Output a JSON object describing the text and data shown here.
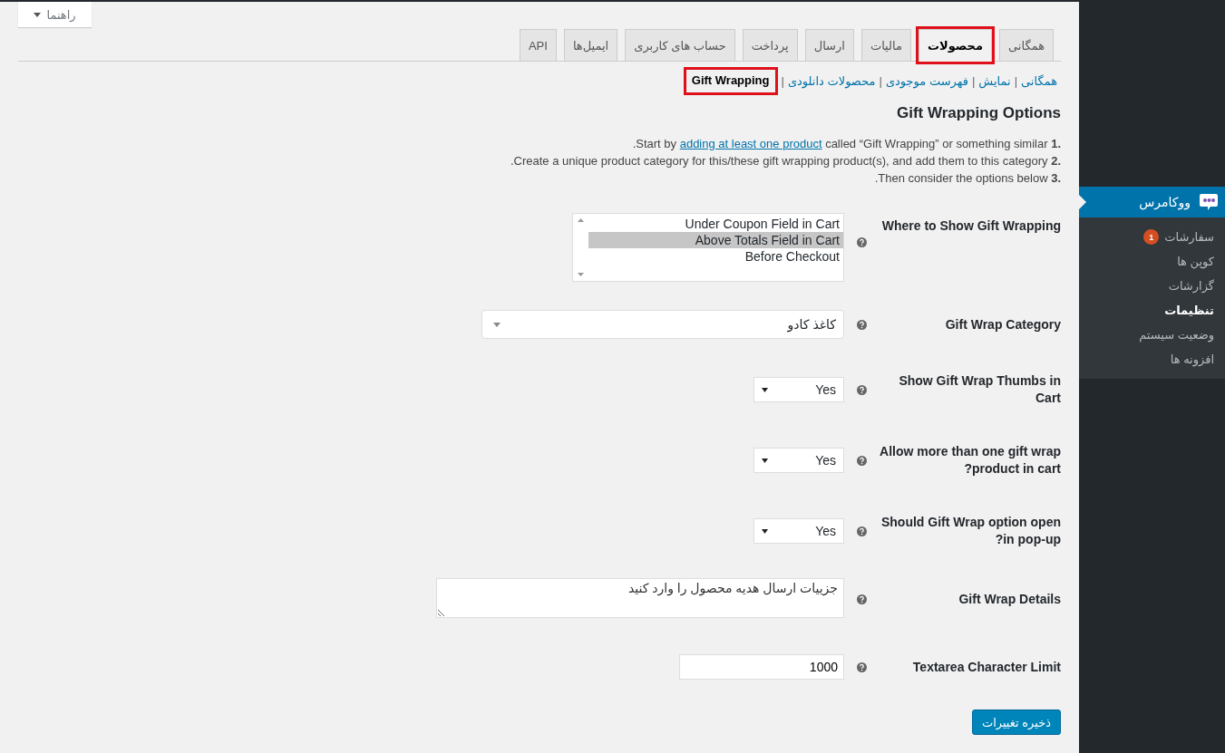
{
  "help_button": {
    "label": "راهنما"
  },
  "tabs": [
    {
      "label": "همگانی",
      "selected": false,
      "highlighted": false
    },
    {
      "label": "محصولات",
      "selected": true,
      "highlighted": true
    },
    {
      "label": "مالیات",
      "selected": false,
      "highlighted": false
    },
    {
      "label": "ارسال",
      "selected": false,
      "highlighted": false
    },
    {
      "label": "پرداخت",
      "selected": false,
      "highlighted": false
    },
    {
      "label": "حساب های کاربری",
      "selected": false,
      "highlighted": false
    },
    {
      "label": "ایمیل‌ها",
      "selected": false,
      "highlighted": false
    },
    {
      "label": "API",
      "selected": false,
      "highlighted": false
    }
  ],
  "subsections": [
    {
      "label": "همگانی",
      "selected": false,
      "highlighted": false
    },
    {
      "separator": "|",
      "label": "نمایش",
      "selected": false,
      "highlighted": false
    },
    {
      "separator": "|",
      "label": "فهرست موجودی",
      "selected": false,
      "highlighted": false
    },
    {
      "separator": "|",
      "label": "محصولات دانلودی",
      "selected": false,
      "highlighted": false
    },
    {
      "separator": "|",
      "label": "Gift Wrapping",
      "selected": true,
      "highlighted": true
    }
  ],
  "heading": "Gift Wrapping Options",
  "instructions": [
    {
      "number": "1.",
      "before": ".Start by",
      "link": "adding at least one product",
      "after": "called “Gift Wrapping” or something similar"
    },
    {
      "number": "2.",
      "before": ".Create a unique product category for this/these gift wrapping product(s), and add them to this category"
    },
    {
      "number": "3.",
      "before": ".Then consider the options below"
    }
  ],
  "fields": [
    {
      "kind": "listbox",
      "label": "Where to Show Gift Wrapping",
      "options": [
        {
          "label": "Under Coupon Field in Cart",
          "selected": false
        },
        {
          "label": "Above Totals Field in Cart",
          "selected": true
        },
        {
          "label": "Before Checkout",
          "selected": false
        }
      ]
    },
    {
      "kind": "wide-select",
      "label": "Gift Wrap Category",
      "value": "کاغذ کادو"
    },
    {
      "kind": "select",
      "label": "Show Gift Wrap Thumbs in Cart",
      "value": "Yes"
    },
    {
      "kind": "select",
      "label": "Allow more than one gift wrap product in cart?",
      "value": "Yes"
    },
    {
      "kind": "select",
      "label": "Should Gift Wrap option open in pop-up?",
      "value": "Yes"
    },
    {
      "kind": "textarea",
      "label": "Gift Wrap Details",
      "placeholder": "جزییات ارسال هدیه محصول را وارد کنید"
    },
    {
      "kind": "input",
      "label": "Textarea Character Limit",
      "value": "1000"
    }
  ],
  "save_button": "ذخیره تغییرات",
  "sidebar": {
    "title": "ووکامرس",
    "items": [
      {
        "label": "سفارشات",
        "badge": "1",
        "selected": false
      },
      {
        "label": "کوپن ها",
        "selected": false
      },
      {
        "label": "گزارشات",
        "selected": false
      },
      {
        "label": "تنظیمات",
        "selected": true
      },
      {
        "label": "وضعیت سیستم",
        "selected": false
      },
      {
        "label": "افزونه ها",
        "selected": false
      }
    ]
  }
}
